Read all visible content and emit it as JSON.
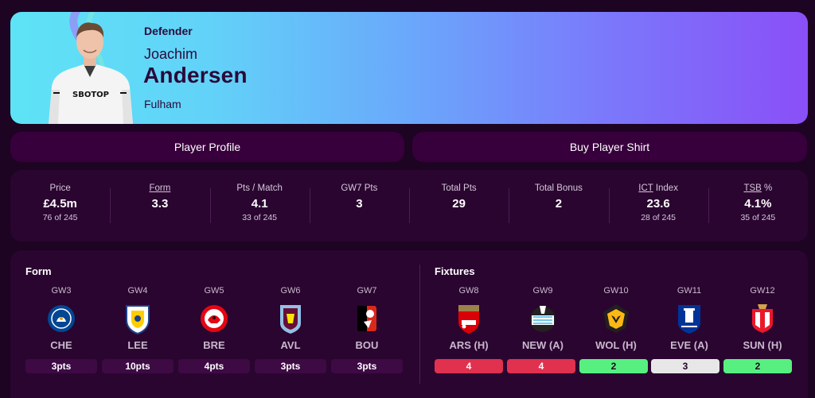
{
  "player": {
    "position": "Defender",
    "first_name": "Joachim",
    "last_name": "Andersen",
    "team": "Fulham",
    "shirt_text": "SBOTOP"
  },
  "buttons": {
    "profile": "Player Profile",
    "shirt": "Buy Player Shirt"
  },
  "stats": [
    {
      "label": "Price",
      "value": "£4.5m",
      "rank": "76 of 245",
      "underline": false
    },
    {
      "label": "Form",
      "value": "3.3",
      "rank": "",
      "underline": true
    },
    {
      "label": "Pts / Match",
      "value": "4.1",
      "rank": "33 of 245",
      "underline": false
    },
    {
      "label": "GW7 Pts",
      "value": "3",
      "rank": "",
      "underline": false
    },
    {
      "label": "Total Pts",
      "value": "29",
      "rank": "",
      "underline": false
    },
    {
      "label": "Total Bonus",
      "value": "2",
      "rank": "",
      "underline": false
    },
    {
      "label": "ICT Index",
      "label_abbr": "ICT",
      "label_rest": " Index",
      "value": "23.6",
      "rank": "28 of 245",
      "underline": false
    },
    {
      "label": "TSB %",
      "label_abbr": "TSB",
      "label_rest": " %",
      "value": "4.1%",
      "rank": "35 of 245",
      "underline": false
    }
  ],
  "form": {
    "title": "Form",
    "items": [
      {
        "gw": "GW3",
        "team": "CHE",
        "points": "3pts",
        "crest": "chelsea-crest"
      },
      {
        "gw": "GW4",
        "team": "LEE",
        "points": "10pts",
        "crest": "leeds-crest"
      },
      {
        "gw": "GW5",
        "team": "BRE",
        "points": "4pts",
        "crest": "brentford-crest"
      },
      {
        "gw": "GW6",
        "team": "AVL",
        "points": "3pts",
        "crest": "aston-villa-crest"
      },
      {
        "gw": "GW7",
        "team": "BOU",
        "points": "3pts",
        "crest": "bournemouth-crest"
      }
    ]
  },
  "fixtures": {
    "title": "Fixtures",
    "items": [
      {
        "gw": "GW8",
        "team": "ARS (H)",
        "difficulty": "4",
        "color": "#e0314e",
        "text_color": "#ffffff",
        "crest": "arsenal-crest"
      },
      {
        "gw": "GW9",
        "team": "NEW (A)",
        "difficulty": "4",
        "color": "#e0314e",
        "text_color": "#ffffff",
        "crest": "newcastle-crest"
      },
      {
        "gw": "GW10",
        "team": "WOL (H)",
        "difficulty": "2",
        "color": "#57f080",
        "text_color": "#1d0422",
        "crest": "wolves-crest"
      },
      {
        "gw": "GW11",
        "team": "EVE (A)",
        "difficulty": "3",
        "color": "#e7e7e7",
        "text_color": "#1d0422",
        "crest": "everton-crest"
      },
      {
        "gw": "GW12",
        "team": "SUN (H)",
        "difficulty": "2",
        "color": "#57f080",
        "text_color": "#1d0422",
        "crest": "sunderland-crest"
      }
    ]
  }
}
